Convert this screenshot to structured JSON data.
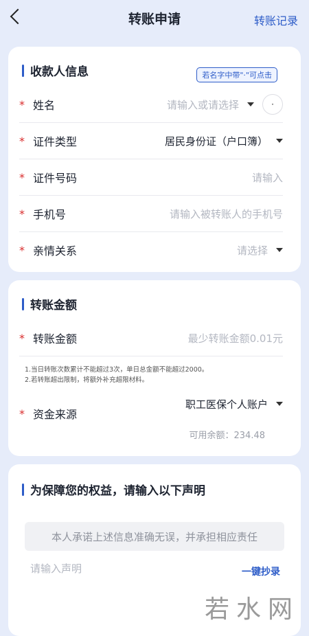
{
  "header": {
    "title": "转账申请",
    "records_link": "转账记录"
  },
  "payee": {
    "section_title": "收款人信息",
    "name_hint": "若名字中带\"·\"可点击",
    "dot_button": "·",
    "fields": {
      "name": {
        "label": "姓名",
        "placeholder": "请输入或请选择"
      },
      "id_type": {
        "label": "证件类型",
        "value": "居民身份证（户口簿）"
      },
      "id_number": {
        "label": "证件号码",
        "placeholder": "请输入"
      },
      "phone": {
        "label": "手机号",
        "placeholder": "请输入被转账人的手机号"
      },
      "relation": {
        "label": "亲情关系",
        "placeholder": "请选择"
      }
    }
  },
  "amount": {
    "section_title": "转账金额",
    "label": "转账金额",
    "placeholder": "最少转账金额0.01元",
    "note1": "1.当日转账次数累计不能超过3次，单日总金额不能超过2000。",
    "note2": "2.若转账超出限制，将额外补充超限材料。",
    "source_label": "资金来源",
    "source_value": "职工医保个人账户",
    "available": "可用余额：234.48"
  },
  "declaration": {
    "section_title": "为保障您的权益，请输入以下声明",
    "commitment": "本人承诺上述信息准确无误，并承担相应责任",
    "input_placeholder": "请输入声明",
    "copy_button": "一键抄录"
  },
  "watermark": "若水网",
  "colors": {
    "accent": "#2d5cc8",
    "required": "#d92c2c",
    "background": "#e6ecfa"
  }
}
